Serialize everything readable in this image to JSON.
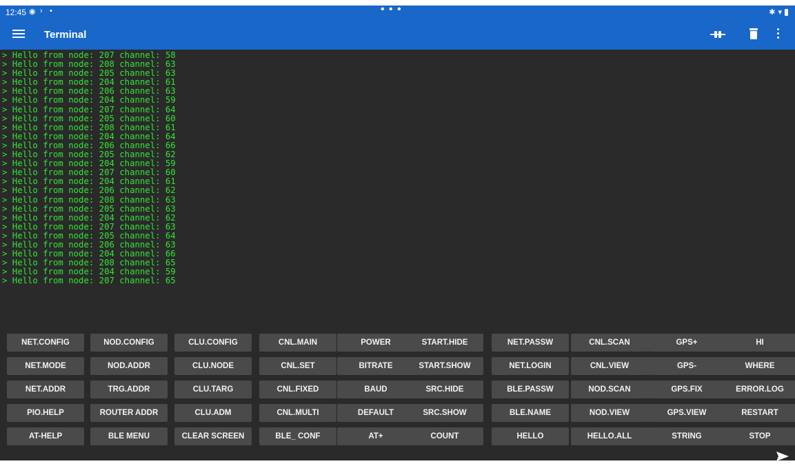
{
  "status_bar": {
    "time": "12:45",
    "dots": "• • •"
  },
  "app_bar": {
    "title": "Terminal"
  },
  "terminal": {
    "lines": [
      "> Hello from node: 207 channel: 58",
      "> Hello from node: 208 channel: 63",
      "> Hello from node: 205 channel: 63",
      "> Hello from node: 204 channel: 61",
      "> Hello from node: 206 channel: 63",
      "> Hello from node: 204 channel: 59",
      "> Hello from node: 207 channel: 64",
      "> Hello from node: 205 channel: 60",
      "> Hello from node: 208 channel: 61",
      "> Hello from node: 204 channel: 64",
      "> Hello from node: 206 channel: 66",
      "> Hello from node: 205 channel: 62",
      "> Hello from node: 204 channel: 59",
      "> Hello from node: 207 channel: 60",
      "> Hello from node: 204 channel: 61",
      "> Hello from node: 206 channel: 62",
      "> Hello from node: 208 channel: 63",
      "> Hello from node: 205 channel: 63",
      "> Hello from node: 204 channel: 62",
      "> Hello from node: 207 channel: 63",
      "> Hello from node: 205 channel: 64",
      "> Hello from node: 206 channel: 63",
      "> Hello from node: 204 channel: 66",
      "> Hello from node: 208 channel: 65",
      "> Hello from node: 204 channel: 59",
      "> Hello from node: 207 channel: 65"
    ]
  },
  "keypad": {
    "rows": [
      [
        "NET.CONFIG",
        "NOD.CONFIG",
        "CLU.CONFIG",
        "CNL.MAIN",
        "POWER",
        "START.HIDE",
        "NET.PASSW",
        "CNL.SCAN",
        "GPS+",
        "HI"
      ],
      [
        "NET.MODE",
        "NOD.ADDR",
        "CLU.NODE",
        "CNL.SET",
        "BITRATE",
        "START.SHOW",
        "NET.LOGIN",
        "CNL.VIEW",
        "GPS-",
        "WHERE"
      ],
      [
        "NET.ADDR",
        "TRG.ADDR",
        "CLU.TARG",
        "CNL.FIXED",
        "BAUD",
        "SRC.HIDE",
        "BLE.PASSW",
        "NOD.SCAN",
        "GPS.FIX",
        "ERROR.LOG"
      ],
      [
        "PIO.HELP",
        "ROUTER ADDR",
        "CLU.ADM",
        "CNL.MULTI",
        "DEFAULT",
        "SRC.SHOW",
        "BLE.NAME",
        "NOD.VIEW",
        "GPS.VIEW",
        "RESTART"
      ],
      [
        "AT-HELP",
        "BLE MENU",
        "CLEAR SCREEN",
        "BLE_ CONF",
        "AT+",
        "COUNT",
        "HELLO",
        "HELLO.ALL",
        "STRING",
        "STOP"
      ]
    ]
  },
  "colors": {
    "app_bar": "#1967c9",
    "terminal_bg": "#2a2a2a",
    "terminal_text": "#32e632",
    "key_bg": "#4a4a4a"
  },
  "icons": [
    "menu-icon",
    "connect-icon",
    "trash-icon",
    "more-vert-icon",
    "send-icon"
  ]
}
